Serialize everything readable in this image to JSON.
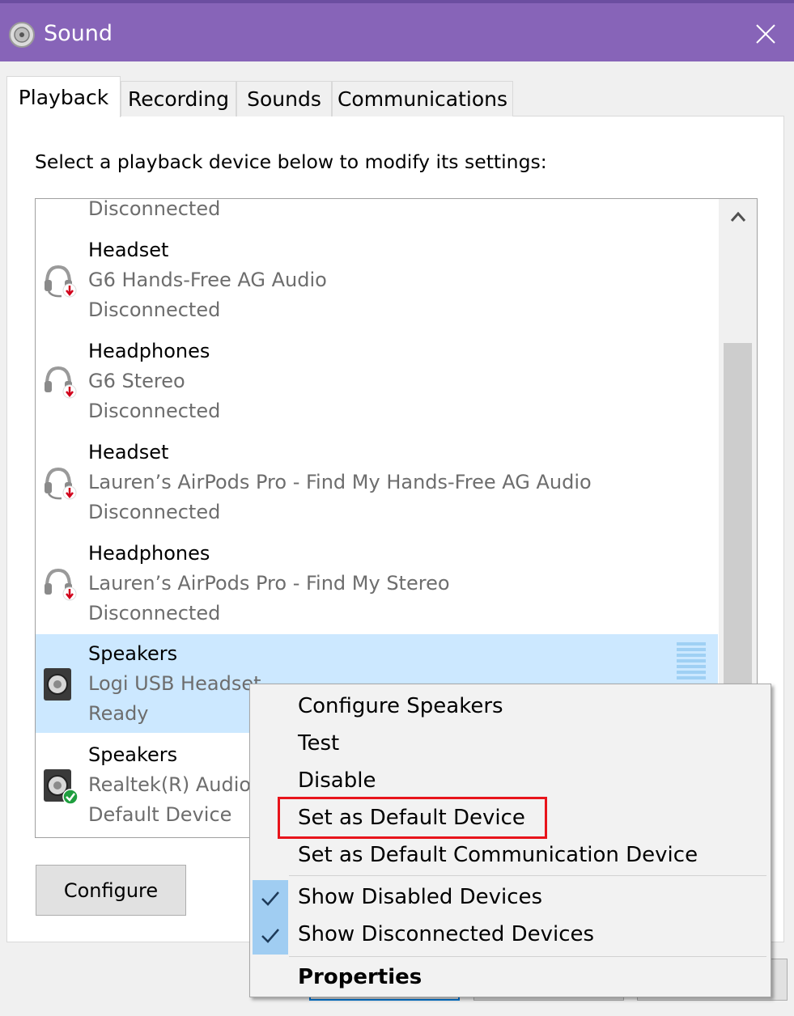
{
  "window": {
    "title": "Sound",
    "icon": "speaker-icon",
    "close_icon": "close-icon"
  },
  "tabs": [
    {
      "label": "Playback",
      "active": true
    },
    {
      "label": "Recording",
      "active": false
    },
    {
      "label": "Sounds",
      "active": false
    },
    {
      "label": "Communications",
      "active": false
    }
  ],
  "instruction": "Select a playback device below to modify its settings:",
  "devices_partial_top": {
    "status": "Disconnected"
  },
  "devices": [
    {
      "name": "Headset",
      "description": "G6 Hands-Free AG Audio",
      "status": "Disconnected",
      "icon": "headset-icon",
      "badge": "disconnected"
    },
    {
      "name": "Headphones",
      "description": "G6 Stereo",
      "status": "Disconnected",
      "icon": "headphones-icon",
      "badge": "disconnected"
    },
    {
      "name": "Headset",
      "description": "Lauren’s AirPods Pro - Find My Hands-Free AG Audio",
      "status": "Disconnected",
      "icon": "headset-icon",
      "badge": "disconnected"
    },
    {
      "name": "Headphones",
      "description": "Lauren’s AirPods Pro - Find My Stereo",
      "status": "Disconnected",
      "icon": "headphones-icon",
      "badge": "disconnected"
    },
    {
      "name": "Speakers",
      "description": "Logi USB Headset",
      "status": "Ready",
      "icon": "speaker-icon",
      "selected": true
    },
    {
      "name": "Speakers",
      "description": "Realtek(R) Audio",
      "status": "Default Device",
      "icon": "speaker-icon",
      "badge": "default"
    }
  ],
  "buttons": {
    "configure": "Configure"
  },
  "context_menu": {
    "items": [
      {
        "label": "Configure Speakers"
      },
      {
        "label": "Test"
      },
      {
        "label": "Disable"
      },
      {
        "label": "Set as Default Device",
        "highlighted": true
      },
      {
        "label": "Set as Default Communication Device"
      },
      {
        "label": "Show Disabled Devices",
        "checked": true
      },
      {
        "label": "Show Disconnected Devices",
        "checked": true
      },
      {
        "label": "Properties",
        "bold": true
      }
    ]
  },
  "colors": {
    "titlebar": "#8764b8",
    "selection": "#cce8ff",
    "highlight_box": "#e8141b",
    "check_bg": "#a0cdf2"
  }
}
